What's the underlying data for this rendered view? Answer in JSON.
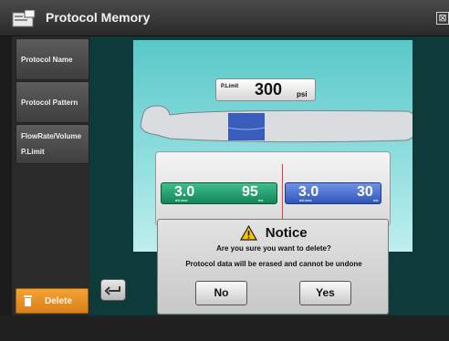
{
  "window": {
    "title": "Protocol Memory",
    "close_glyph": "⊠",
    "app_icon": "protocol-memory-icon"
  },
  "sidebar": {
    "items": [
      {
        "label": "Protocol Name"
      },
      {
        "label": "Protocol Pattern"
      },
      {
        "label": "FlowRate/Volume",
        "label2": "P.Limit"
      }
    ],
    "delete_label": "Delete"
  },
  "pressure_limit": {
    "label": "P.Limit",
    "value": "300",
    "unit": "psi"
  },
  "phases": [
    {
      "left_value": "3.0",
      "left_unit": "mL/sec",
      "right_value": "95",
      "right_unit": "mL",
      "color": "#1e9a68"
    },
    {
      "left_value": "3.0",
      "left_unit": "mL/sec",
      "right_value": "30",
      "right_unit": "mL",
      "color": "#3f66c8"
    }
  ],
  "dialog": {
    "title": "Notice",
    "line1": "Are you sure you want to delete?",
    "line2": "Protocol data will be erased and cannot be undone",
    "no_label": "No",
    "yes_label": "Yes"
  },
  "colors": {
    "accent_orange": "#e88f22",
    "scene_cyan": "#7fd8d8",
    "warning_yellow": "#f5c400"
  }
}
